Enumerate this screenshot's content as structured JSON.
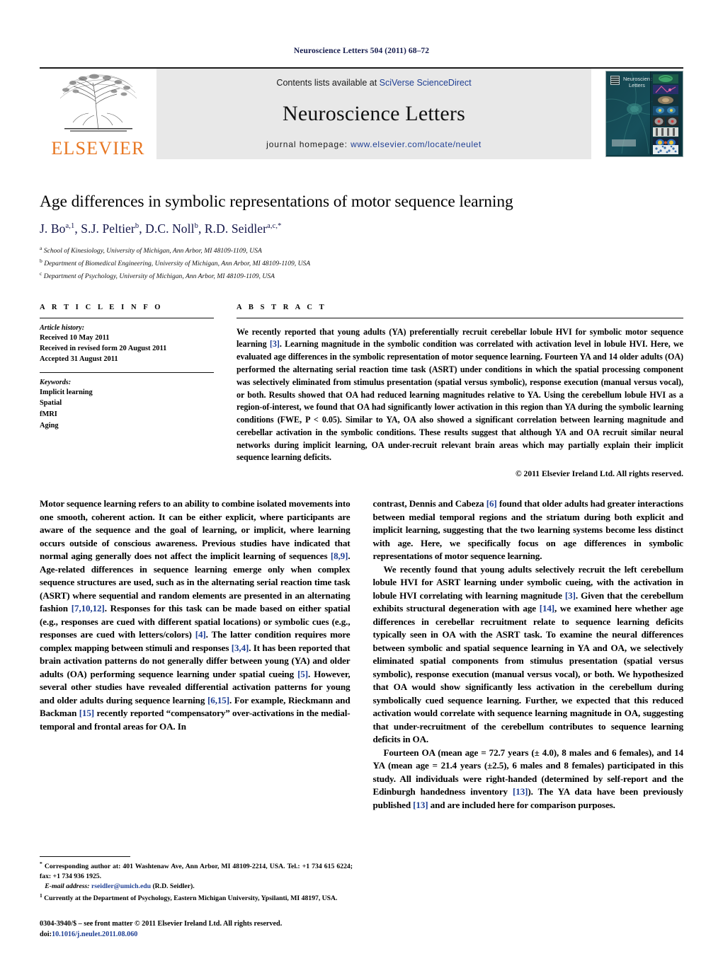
{
  "running_head": "Neuroscience Letters 504 (2011) 68–72",
  "masthead": {
    "publisher": "ELSEVIER",
    "contents_prefix": "Contents lists available at ",
    "contents_link": "SciVerse ScienceDirect",
    "journal_name": "Neuroscience Letters",
    "homepage_prefix": "journal homepage: ",
    "homepage_url": "www.elsevier.com/locate/neulet",
    "cover_title_line1": "Neuroscience",
    "cover_title_line2": "Letters"
  },
  "article": {
    "title": "Age differences in symbolic representations of motor sequence learning",
    "authors_html": "J. Bo<sup>a,1</sup>, S.J. Peltier<sup>b</sup>, D.C. Noll<sup>b</sup>, R.D. Seidler<sup>a,c,*</sup>",
    "affiliations": [
      "School of Kinesiology, University of Michigan, Ann Arbor, MI 48109-1109, USA",
      "Department of Biomedical Engineering, University of Michigan, Ann Arbor, MI 48109-1109, USA",
      "Department of Psychology, University of Michigan, Ann Arbor, MI 48109-1109, USA"
    ],
    "affil_marks": [
      "a",
      "b",
      "c"
    ]
  },
  "info": {
    "heading": "A R T I C L E   I N F O",
    "history_label": "Article history:",
    "history": [
      "Received 10 May 2011",
      "Received in revised form 20 August 2011",
      "Accepted 31 August 2011"
    ],
    "keywords_label": "Keywords:",
    "keywords": [
      "Implicit learning",
      "Spatial",
      "fMRI",
      "Aging"
    ]
  },
  "abstract": {
    "heading": "A B S T R A C T",
    "text_html": "We recently reported that young adults (YA) preferentially recruit cerebellar lobule HVI for symbolic motor sequence learning <span class=\"ref\">[3]</span>. Learning magnitude in the symbolic condition was correlated with activation level in lobule HVI. Here, we evaluated age differences in the symbolic representation of motor sequence learning. Fourteen YA and 14 older adults (OA) performed the alternating serial reaction time task (ASRT) under conditions in which the spatial processing component was selectively eliminated from stimulus presentation (spatial versus symbolic), response execution (manual versus vocal), or both. Results showed that OA had reduced learning magnitudes relative to YA. Using the cerebellum lobule HVI as a region-of-interest, we found that OA had significantly lower activation in this region than YA during the symbolic learning conditions (FWE, P &lt; 0.05). Similar to YA, OA also showed a significant correlation between learning magnitude and cerebellar activation in the symbolic conditions. These results suggest that although YA and OA recruit similar neural networks during implicit learning, OA under-recruit relevant brain areas which may partially explain their implicit sequence learning deficits.",
    "copyright": "© 2011 Elsevier Ireland Ltd. All rights reserved."
  },
  "body": {
    "left_paragraphs_html": [
      "Motor sequence learning refers to an ability to combine isolated movements into one smooth, coherent action. It can be either explicit, where participants are aware of the sequence and the goal of learning, or implicit, where learning occurs outside of conscious awareness. Previous studies have indicated that normal aging generally does not affect the implicit learning of sequences <span class=\"ref\">[8,9]</span>. Age-related differences in sequence learning emerge only when complex sequence structures are used, such as in the alternating serial reaction time task (ASRT) where sequential and random elements are presented in an alternating fashion <span class=\"ref\">[7,10,12]</span>. Responses for this task can be made based on either spatial (e.g., responses are cued with different spatial locations) or symbolic cues (e.g., responses are cued with letters/colors) <span class=\"ref\">[4]</span>. The latter condition requires more complex mapping between stimuli and responses <span class=\"ref\">[3,4]</span>. It has been reported that brain activation patterns do not generally differ between young (YA) and older adults (OA) performing sequence learning under spatial cueing <span class=\"ref\">[5]</span>. However, several other studies have revealed differential activation patterns for young and older adults during sequence learning <span class=\"ref\">[6,15]</span>. For example, Rieckmann and Backman <span class=\"ref\">[15]</span> recently reported “compensatory” over-activations in the medial-temporal and frontal areas for OA. In"
    ],
    "right_paragraphs_html": [
      "contrast, Dennis and Cabeza <span class=\"ref\">[6]</span> found that older adults had greater interactions between medial temporal regions and the striatum during both explicit and implicit learning, suggesting that the two learning systems become less distinct with age. Here, we specifically focus on age differences in symbolic representations of motor sequence learning.",
      "We recently found that young adults selectively recruit the left cerebellum lobule HVI for ASRT learning under symbolic cueing, with the activation in lobule HVI correlating with learning magnitude <span class=\"ref\">[3]</span>. Given that the cerebellum exhibits structural degeneration with age <span class=\"ref\">[14]</span>, we examined here whether age differences in cerebellar recruitment relate to sequence learning deficits typically seen in OA with the ASRT task. To examine the neural differences between symbolic and spatial sequence learning in YA and OA, we selectively eliminated spatial components from stimulus presentation (spatial versus symbolic), response execution (manual versus vocal), or both. We hypothesized that OA would show significantly less activation in the cerebellum during symbolically cued sequence learning. Further, we expected that this reduced activation would correlate with sequence learning magnitude in OA, suggesting that under-recruitment of the cerebellum contributes to sequence learning deficits in OA.",
      "Fourteen OA (mean age = 72.7 years (± 4.0), 8 males and 6 females), and 14 YA (mean age = 21.4 years (±2.5), 6 males and 8 females) participated in this study. All individuals were right-handed (determined by self-report and the Edinburgh handedness inventory <span class=\"ref\">[13]</span>). The YA data have been previously published <span class=\"ref\">[13]</span> and are included here for comparison purposes."
    ]
  },
  "footnotes": {
    "corresponding_html": "<sup>*</sup> Corresponding author at: 401 Washtenaw Ave, Ann Arbor, MI 48109-2214, USA. Tel.: +1 734 615 6224; fax: +1 734 936 1925.",
    "email_label": "E-mail address:",
    "email": "rseidler@umich.edu",
    "email_suffix": "(R.D. Seidler).",
    "note1_html": "<sup>1</sup> Currently at the Department of Psychology, Eastern Michigan University, Ypsilanti, MI 48197, USA."
  },
  "imprint": {
    "line1": "0304-3940/$ – see front matter © 2011 Elsevier Ireland Ltd. All rights reserved.",
    "doi_prefix": "doi:",
    "doi": "10.1016/j.neulet.2011.08.060"
  },
  "colors": {
    "link": "#1f3f94",
    "running_head": "#141b4d",
    "elsevier_orange": "#e87722",
    "masthead_bg": "#e8e8e8"
  }
}
